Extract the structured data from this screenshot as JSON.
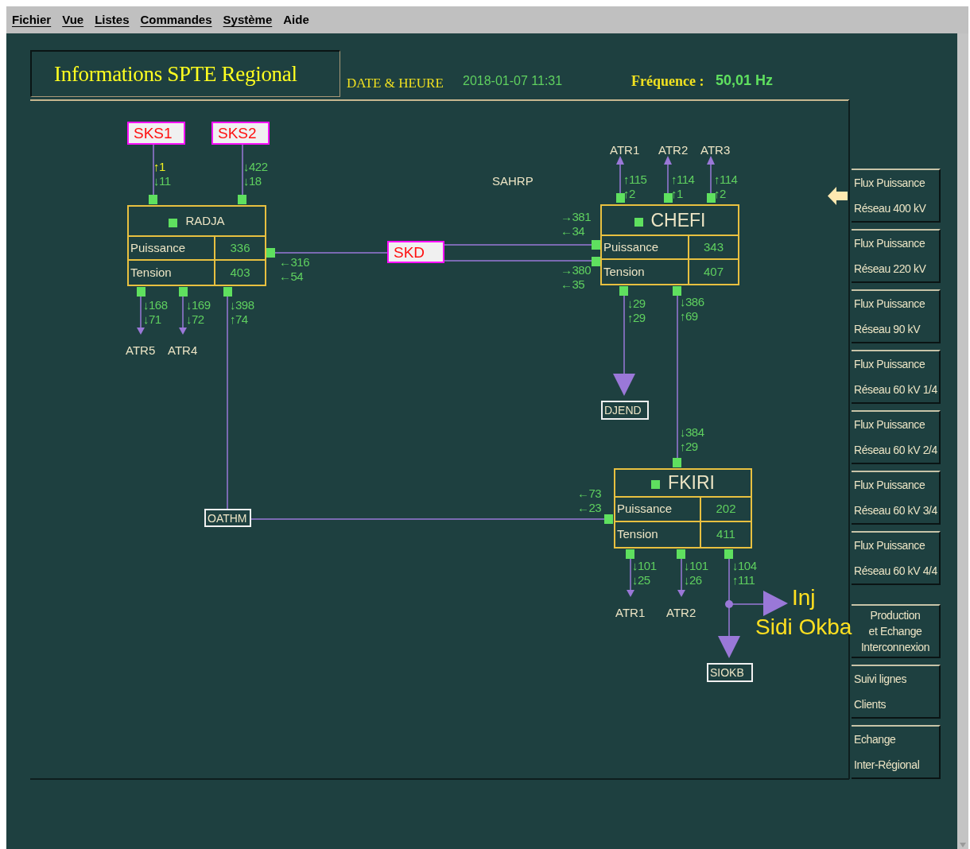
{
  "menu": [
    {
      "label": "Fichier",
      "underlined": true
    },
    {
      "label": "Vue",
      "underlined": true
    },
    {
      "label": "Listes",
      "underlined": true
    },
    {
      "label": "Commandes",
      "underlined": true
    },
    {
      "label": "Système",
      "underlined": true
    },
    {
      "label": "Aide",
      "underlined": false
    }
  ],
  "header": {
    "title": "Informations SPTE Regional",
    "date_label": "DATE & HEURE",
    "date_value": "2018-01-07 11:31",
    "frequency_label": "Fréquence :",
    "frequency_value": "50,01 Hz"
  },
  "stations": [
    {
      "name": "RADJA",
      "rows": [
        {
          "label": "Puissance",
          "value": "336"
        },
        {
          "label": "Tension",
          "value": "403"
        }
      ]
    },
    {
      "name": "CHEFI",
      "rows": [
        {
          "label": "Puissance",
          "value": "343"
        },
        {
          "label": "Tension",
          "value": "407"
        }
      ]
    },
    {
      "name": "FKIRI",
      "rows": [
        {
          "label": "Puissance",
          "value": "202"
        },
        {
          "label": "Tension",
          "value": "411"
        }
      ]
    }
  ],
  "nodes": [
    {
      "label": "SKS1",
      "kind": "alarm"
    },
    {
      "label": "SKS2",
      "kind": "alarm"
    },
    {
      "label": "SKD",
      "kind": "alarm"
    },
    {
      "label": "DJEND",
      "kind": "plain"
    },
    {
      "label": "OATHM",
      "kind": "plain"
    },
    {
      "label": "SIOKB",
      "kind": "plain"
    }
  ],
  "labels": [
    {
      "text": "ATR5",
      "kind": "plain"
    },
    {
      "text": "ATR4",
      "kind": "plain"
    },
    {
      "text": "ATR1",
      "kind": "plain"
    },
    {
      "text": "ATR2",
      "kind": "plain"
    },
    {
      "text": "ATR3",
      "kind": "plain"
    },
    {
      "text": "SAHRP",
      "kind": "plain"
    },
    {
      "text": "ATR1",
      "kind": "plain"
    },
    {
      "text": "ATR2",
      "kind": "plain"
    },
    {
      "text": "Inj",
      "kind": "injection"
    },
    {
      "text": "Sidi Okba",
      "kind": "injection"
    }
  ],
  "flows": [
    {
      "lines": [
        {
          "text": "↑1",
          "alert": true
        },
        {
          "text": "↓11",
          "alert": false
        }
      ]
    },
    {
      "lines": [
        {
          "text": "↓422",
          "alert": false
        },
        {
          "text": "↓18",
          "alert": false
        }
      ]
    },
    {
      "lines": [
        {
          "text": "←316",
          "alert": false
        },
        {
          "text": "←54",
          "alert": false
        }
      ]
    },
    {
      "lines": [
        {
          "text": "↓168",
          "alert": false
        },
        {
          "text": "↓71",
          "alert": false
        }
      ]
    },
    {
      "lines": [
        {
          "text": "↓169",
          "alert": false
        },
        {
          "text": "↓72",
          "alert": false
        }
      ]
    },
    {
      "lines": [
        {
          "text": "↓398",
          "alert": false
        },
        {
          "text": "↑74",
          "alert": false
        }
      ]
    },
    {
      "lines": [
        {
          "text": "→381",
          "alert": false
        },
        {
          "text": "←34",
          "alert": false
        }
      ]
    },
    {
      "lines": [
        {
          "text": "→380",
          "alert": false
        },
        {
          "text": "←35",
          "alert": false
        }
      ]
    },
    {
      "lines": [
        {
          "text": "↑115",
          "alert": false
        },
        {
          "text": "↑2",
          "alert": false
        }
      ]
    },
    {
      "lines": [
        {
          "text": "↑114",
          "alert": false
        },
        {
          "text": "↑1",
          "alert": false
        }
      ]
    },
    {
      "lines": [
        {
          "text": "↑114",
          "alert": false
        },
        {
          "text": "↑2",
          "alert": false
        }
      ]
    },
    {
      "lines": [
        {
          "text": "↓29",
          "alert": false
        },
        {
          "text": "↑29",
          "alert": false
        }
      ]
    },
    {
      "lines": [
        {
          "text": "↓386",
          "alert": false
        },
        {
          "text": "↑69",
          "alert": false
        }
      ]
    },
    {
      "lines": [
        {
          "text": "↓384",
          "alert": false
        },
        {
          "text": "↑29",
          "alert": false
        }
      ]
    },
    {
      "lines": [
        {
          "text": "←73",
          "alert": false
        },
        {
          "text": "←23",
          "alert": false
        }
      ]
    },
    {
      "lines": [
        {
          "text": "↓101",
          "alert": false
        },
        {
          "text": "↓25",
          "alert": false
        }
      ]
    },
    {
      "lines": [
        {
          "text": "↓101",
          "alert": false
        },
        {
          "text": "↓26",
          "alert": false
        }
      ]
    },
    {
      "lines": [
        {
          "text": "↓104",
          "alert": false
        },
        {
          "text": "↑111",
          "alert": false
        }
      ]
    }
  ],
  "sidebar": [
    {
      "lines": [
        "Flux Puissance",
        "Réseau 400 kV"
      ],
      "selected": true
    },
    {
      "lines": [
        "Flux Puissance",
        "Réseau 220 kV"
      ],
      "selected": false
    },
    {
      "lines": [
        "Flux Puissance",
        "Réseau 90 kV"
      ],
      "selected": false
    },
    {
      "lines": [
        "Flux Puissance",
        "Réseau 60 kV 1/4"
      ],
      "selected": false
    },
    {
      "lines": [
        "Flux Puissance",
        "Réseau 60 kV 2/4"
      ],
      "selected": false
    },
    {
      "lines": [
        "Flux Puissance",
        "Réseau 60 kV 3/4"
      ],
      "selected": false
    },
    {
      "lines": [
        "Flux Puissance",
        "Réseau 60 kV 4/4"
      ],
      "selected": false
    },
    {
      "lines": [
        "Production",
        "et Echange",
        "Interconnexion"
      ],
      "selected": false
    },
    {
      "lines": [
        "Suivi lignes",
        "Clients"
      ],
      "selected": false
    },
    {
      "lines": [
        "Echange",
        "Inter-Régional"
      ],
      "selected": false
    }
  ]
}
